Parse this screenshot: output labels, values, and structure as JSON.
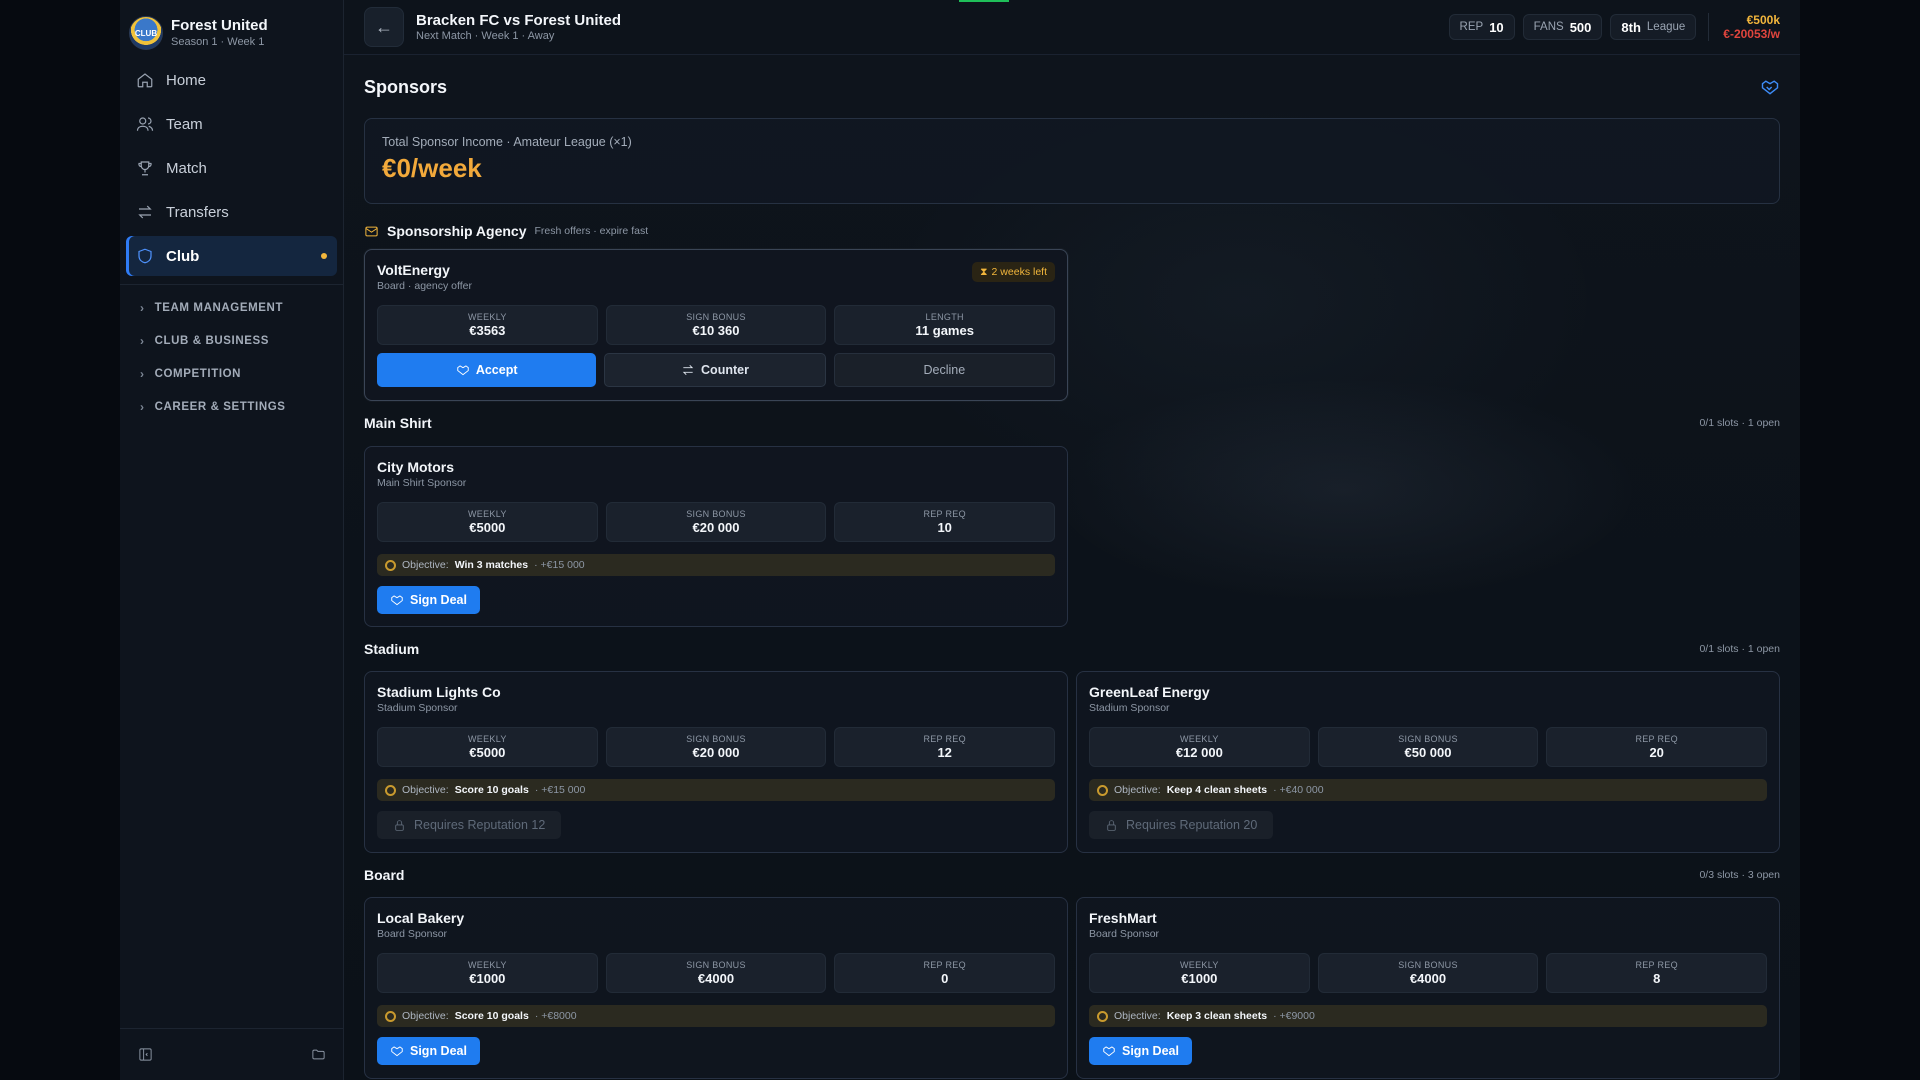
{
  "sidebar": {
    "club_name": "Forest United",
    "club_sub": "Season 1 · Week 1",
    "logo_text": "CLUB",
    "nav": [
      {
        "label": "Home",
        "icon": "home-icon"
      },
      {
        "label": "Team",
        "icon": "users-icon"
      },
      {
        "label": "Match",
        "icon": "trophy-icon"
      },
      {
        "label": "Transfers",
        "icon": "transfer-icon"
      },
      {
        "label": "Club",
        "icon": "shield-icon",
        "active": true
      }
    ],
    "groups": [
      "TEAM MANAGEMENT",
      "CLUB & BUSINESS",
      "COMPETITION",
      "CAREER & SETTINGS"
    ]
  },
  "topbar": {
    "match_title": "Bracken FC vs Forest United",
    "match_sub": "Next Match · Week 1 · Away",
    "rep_label": "REP",
    "rep_value": "10",
    "fans_label": "FANS",
    "fans_value": "500",
    "league_pos": "8th",
    "league_label": "League",
    "balance": "€500k",
    "weekly_rate": "€-20053/w"
  },
  "page": {
    "title": "Sponsors",
    "income_label": "Total Sponsor Income · Amateur League (×1)",
    "income_value": "€0/week"
  },
  "agency": {
    "title": "Sponsorship Agency",
    "subtitle": "Fresh offers · expire fast",
    "offer": {
      "name": "VoltEnergy",
      "type": "Board · agency offer",
      "time_left": "2 weeks left",
      "stats": [
        {
          "label": "WEEKLY",
          "value": "€3563"
        },
        {
          "label": "SIGN BONUS",
          "value": "€10 360"
        },
        {
          "label": "LENGTH",
          "value": "11 games"
        }
      ],
      "accept": "Accept",
      "counter": "Counter",
      "decline": "Decline"
    }
  },
  "sections": {
    "main_shirt": {
      "title": "Main Shirt",
      "slots": "0/1 slots · 1 open"
    },
    "stadium": {
      "title": "Stadium",
      "slots": "0/1 slots · 1 open"
    },
    "board": {
      "title": "Board",
      "slots": "0/3 slots · 3 open"
    }
  },
  "labels": {
    "weekly": "WEEKLY",
    "sign_bonus": "SIGN BONUS",
    "rep_req": "REP REQ",
    "objective": "Objective:",
    "sign_deal": "Sign Deal"
  },
  "sponsors": {
    "city_motors": {
      "name": "City Motors",
      "type": "Main Shirt Sponsor",
      "weekly": "€5000",
      "bonus": "€20 000",
      "rep": "10",
      "objective": "Win 3 matches",
      "reward": "· +€15 000"
    },
    "stadium_lights": {
      "name": "Stadium Lights Co",
      "type": "Stadium Sponsor",
      "weekly": "€5000",
      "bonus": "€20 000",
      "rep": "12",
      "objective": "Score 10 goals",
      "reward": "· +€15 000",
      "locked": "Requires Reputation 12"
    },
    "greenleaf": {
      "name": "GreenLeaf Energy",
      "type": "Stadium Sponsor",
      "weekly": "€12 000",
      "bonus": "€50 000",
      "rep": "20",
      "objective": "Keep 4 clean sheets",
      "reward": "· +€40 000",
      "locked": "Requires Reputation 20"
    },
    "local_bakery": {
      "name": "Local Bakery",
      "type": "Board Sponsor",
      "weekly": "€1000",
      "bonus": "€4000",
      "rep": "0",
      "objective": "Score 10 goals",
      "reward": "· +€8000"
    },
    "freshmart": {
      "name": "FreshMart",
      "type": "Board Sponsor",
      "weekly": "€1000",
      "bonus": "€4000",
      "rep": "8",
      "objective": "Keep 3 clean sheets",
      "reward": "· +€9000"
    }
  },
  "colors": {
    "accent": "#1f7cf0",
    "income": "#f2a93b",
    "negative": "#e0453d",
    "warning": "#f2b63c"
  }
}
